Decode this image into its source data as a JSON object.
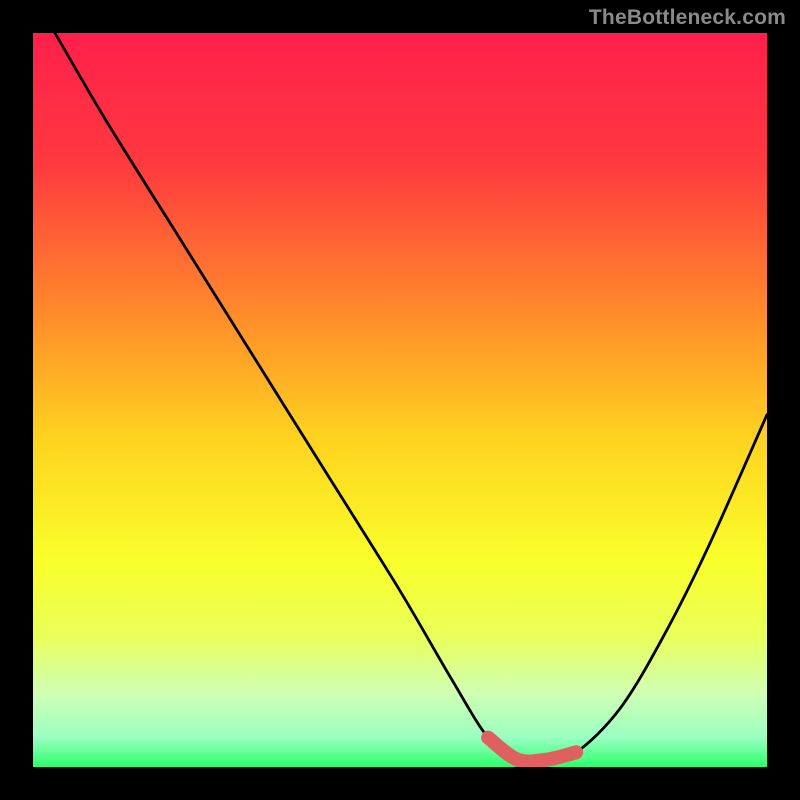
{
  "watermark": "TheBottleneck.com",
  "chart_data": {
    "type": "line",
    "title": "",
    "xlabel": "",
    "ylabel": "",
    "xlim": [
      0,
      100
    ],
    "ylim": [
      0,
      100
    ],
    "curve": {
      "x": [
        3,
        10,
        20,
        30,
        40,
        50,
        57,
        62,
        66,
        70,
        74,
        80,
        86,
        92,
        100
      ],
      "y": [
        100,
        88,
        72,
        56,
        40,
        24,
        12,
        4,
        1,
        1,
        2,
        8,
        18,
        30,
        48
      ]
    },
    "highlight_segment": {
      "x_start": 62,
      "x_end": 74
    },
    "gradient_stops": [
      {
        "offset": 0,
        "color": "#ff1f4b"
      },
      {
        "offset": 0.18,
        "color": "#ff3a3f"
      },
      {
        "offset": 0.38,
        "color": "#ff8a2b"
      },
      {
        "offset": 0.55,
        "color": "#ffd21f"
      },
      {
        "offset": 0.72,
        "color": "#f9ff2b"
      },
      {
        "offset": 0.82,
        "color": "#eaff58"
      },
      {
        "offset": 0.9,
        "color": "#cfffb4"
      },
      {
        "offset": 0.96,
        "color": "#9affc2"
      },
      {
        "offset": 1.0,
        "color": "#2bff6b"
      }
    ]
  }
}
